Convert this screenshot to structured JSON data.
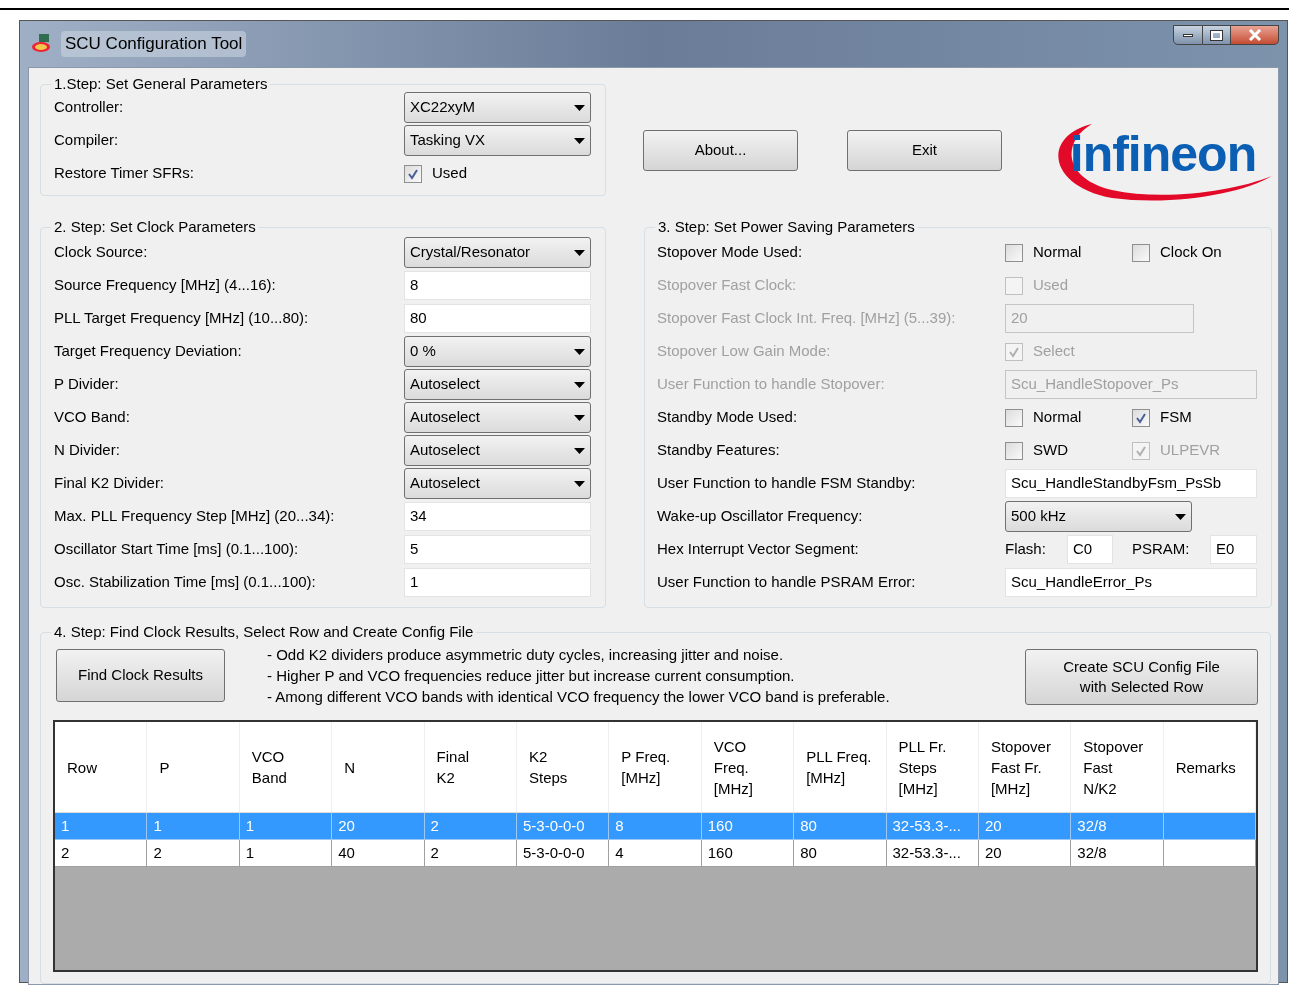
{
  "window": {
    "title": "SCU Configuration Tool"
  },
  "general": {
    "title": "1.Step: Set General Parameters",
    "rows": [
      {
        "label": "Controller:",
        "kind": "dropdown",
        "value": "XC22xyM"
      },
      {
        "label": "Compiler:",
        "kind": "dropdown",
        "value": "Tasking VX"
      },
      {
        "label": "Restore Timer SFRs:",
        "kind": "checks",
        "checks": [
          {
            "label": "Used",
            "checked": true,
            "disabled": false
          }
        ]
      }
    ]
  },
  "buttons": [
    "About...",
    "Exit"
  ],
  "logo": {
    "text": "infineon"
  },
  "clock": {
    "title": "2. Step: Set Clock Parameters",
    "rows": [
      {
        "label": "Clock Source:",
        "kind": "dropdown",
        "value": "Crystal/Resonator"
      },
      {
        "label": "Source Frequency [MHz] (4...16):",
        "kind": "input",
        "value": "8"
      },
      {
        "label": "PLL Target Frequency [MHz] (10...80):",
        "kind": "input",
        "value": "80"
      },
      {
        "label": "Target Frequency Deviation:",
        "kind": "dropdown",
        "value": "0 %"
      },
      {
        "label": "P Divider:",
        "kind": "dropdown",
        "value": "Autoselect"
      },
      {
        "label": "VCO Band:",
        "kind": "dropdown",
        "value": "Autoselect"
      },
      {
        "label": "N Divider:",
        "kind": "dropdown",
        "value": "Autoselect"
      },
      {
        "label": "Final K2 Divider:",
        "kind": "dropdown",
        "value": "Autoselect"
      },
      {
        "label": "Max. PLL Frequency Step [MHz] (20...34):",
        "kind": "input",
        "value": "34"
      },
      {
        "label": "Oscillator Start Time [ms] (0.1...100):",
        "kind": "input",
        "value": "5"
      },
      {
        "label": "Osc. Stabilization Time [ms] (0.1...100):",
        "kind": "input",
        "value": "1"
      }
    ]
  },
  "power": {
    "title": "3. Step: Set Power Saving Parameters",
    "rows": [
      {
        "label": "Stopover Mode Used:",
        "kind": "checks",
        "disabled": false,
        "checks": [
          {
            "label": "Normal",
            "checked": false,
            "disabled": false
          },
          {
            "label": "Clock On",
            "checked": false,
            "disabled": false
          }
        ]
      },
      {
        "label": "Stopover Fast Clock:",
        "kind": "checks",
        "disabled": true,
        "checks": [
          {
            "label": "Used",
            "checked": false,
            "disabled": true
          }
        ]
      },
      {
        "label": "Stopover Fast Clock Int. Freq. [MHz] (5...39):",
        "kind": "short_input",
        "disabled": true,
        "value": "20"
      },
      {
        "label": "Stopover Low Gain Mode:",
        "kind": "checks",
        "disabled": true,
        "checks": [
          {
            "label": "Select",
            "checked": true,
            "disabled": true
          }
        ]
      },
      {
        "label": "User Function to handle Stopover:",
        "kind": "input",
        "disabled": true,
        "value": "Scu_HandleStopover_Ps"
      },
      {
        "label": "Standby Mode Used:",
        "kind": "checks",
        "disabled": false,
        "checks": [
          {
            "label": "Normal",
            "checked": false,
            "disabled": false
          },
          {
            "label": "FSM",
            "checked": true,
            "disabled": false
          }
        ]
      },
      {
        "label": "Standby Features:",
        "kind": "checks",
        "disabled": false,
        "checks": [
          {
            "label": "SWD",
            "checked": false,
            "disabled": false
          },
          {
            "label": "ULPEVR",
            "checked": true,
            "disabled": true
          }
        ]
      },
      {
        "label": "User Function to handle FSM Standby:",
        "kind": "input",
        "disabled": false,
        "value": "Scu_HandleStandbyFsm_PsSb"
      },
      {
        "label": "Wake-up Oscillator Frequency:",
        "kind": "dropdown",
        "disabled": false,
        "value": "500 kHz"
      },
      {
        "label": "Hex Interrupt Vector Segment:",
        "kind": "pair",
        "disabled": false,
        "fields": [
          {
            "label": "Flash:",
            "value": "C0"
          },
          {
            "label": "PSRAM:",
            "value": "E0"
          }
        ]
      },
      {
        "label": "User Function to handle PSRAM Error:",
        "kind": "input",
        "disabled": false,
        "value": "Scu_HandleError_Ps"
      }
    ]
  },
  "results": {
    "title": "4. Step:  Find Clock Results, Select Row and Create Config File",
    "find_button": "Find Clock Results",
    "notes": [
      "- Odd K2 dividers produce asymmetric duty cycles, increasing jitter and noise.",
      "- Higher P and VCO frequencies reduce jitter but increase current consumption.",
      "- Among different VCO bands with identical VCO frequency the lower VCO band is preferable."
    ],
    "create_button": [
      "Create SCU Config File",
      "with Selected Row"
    ]
  },
  "table": {
    "columns": [
      "Row",
      "P",
      "VCO\nBand",
      "N",
      "Final\nK2",
      "K2\nSteps",
      "P Freq.\n[MHz]",
      "VCO\nFreq.\n[MHz]",
      "PLL Freq.\n[MHz]",
      "PLL Fr.\nSteps\n[MHz]",
      "Stopover\nFast Fr.\n[MHz]",
      "Stopover\nFast\nN/K2",
      "Remarks"
    ],
    "rows": [
      {
        "selected": true,
        "cells": [
          "1",
          "1",
          "1",
          "20",
          "2",
          "5-3-0-0-0",
          "8",
          "160",
          "80",
          "32-53.3-...",
          "20",
          "32/8"
        ]
      },
      {
        "selected": false,
        "cells": [
          "2",
          "2",
          "1",
          "40",
          "2",
          "5-3-0-0-0",
          "4",
          "160",
          "80",
          "32-53.3-...",
          "20",
          "32/8"
        ]
      }
    ]
  }
}
